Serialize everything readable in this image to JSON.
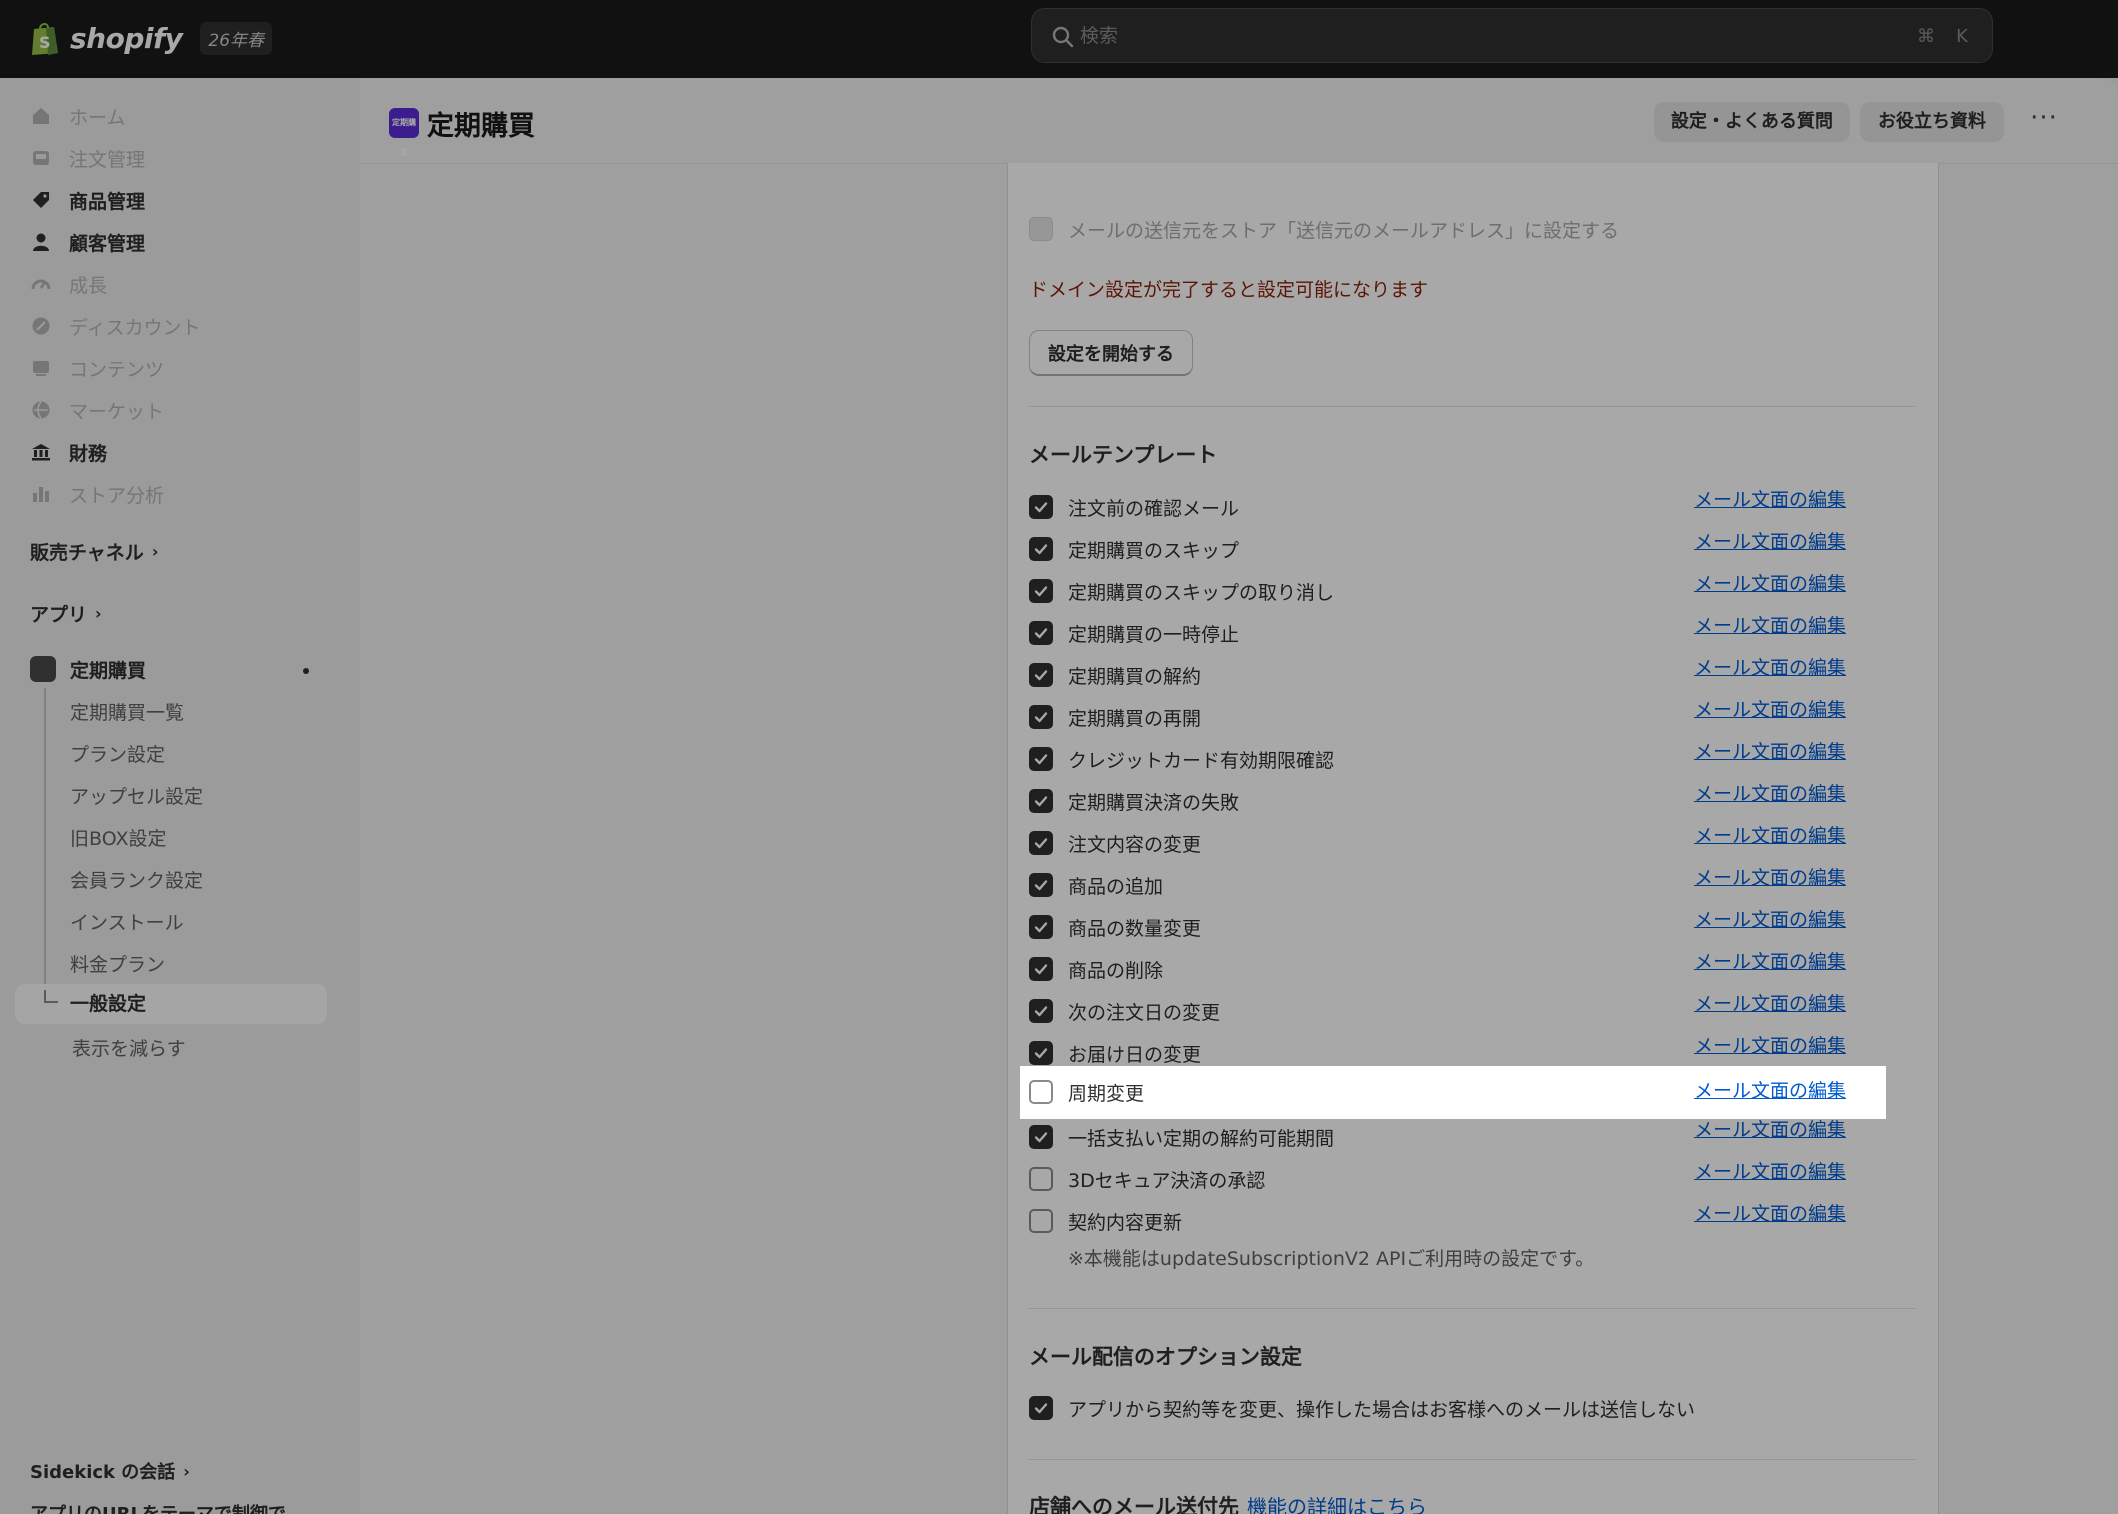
{
  "topbar": {
    "brand": "shopify",
    "badge": "26年春",
    "search_placeholder": "検索",
    "shortcut_cmd": "⌘",
    "shortcut_key": "K"
  },
  "sidebar": {
    "nav": [
      {
        "label": "ホーム",
        "icon": "home-icon"
      },
      {
        "label": "注文管理",
        "icon": "inbox-icon"
      },
      {
        "label": "商品管理",
        "icon": "tag-icon"
      },
      {
        "label": "顧客管理",
        "icon": "person-icon"
      },
      {
        "label": "成長",
        "icon": "gauge-icon"
      },
      {
        "label": "ディスカウント",
        "icon": "discount-icon"
      },
      {
        "label": "コンテンツ",
        "icon": "content-icon"
      },
      {
        "label": "マーケット",
        "icon": "globe-icon"
      },
      {
        "label": "財務",
        "icon": "bank-icon"
      },
      {
        "label": "ストア分析",
        "icon": "bar-chart-icon"
      }
    ],
    "sales_channel": "販売チャネル",
    "apps": "アプリ",
    "app_name": "定期購買",
    "app_subitems": [
      "定期購買一覧",
      "プラン設定",
      "アップセル設定",
      "旧BOX設定",
      "会員ランク設定",
      "インストール",
      "料金プラン",
      "一般設定"
    ],
    "show_less": "表示を減らす",
    "sidekick": "Sidekick の会話",
    "footer_cut": "アプリのURLをテーマで制御で"
  },
  "header": {
    "icon_label": "定期購買",
    "title": "定期購買",
    "btn_faq": "設定・よくある質問",
    "btn_docs": "お役立ち資料",
    "more": "···"
  },
  "sender": {
    "checkbox_label": "メールの送信元をストア「送信元のメールアドレス」に設定する",
    "warning": "ドメイン設定が完了すると設定可能になります",
    "start_button": "設定を開始する"
  },
  "templates": {
    "title": "メールテンプレート",
    "edit_label": "メール文面の編集",
    "items": [
      {
        "label": "注文前の確認メール",
        "checked": true
      },
      {
        "label": "定期購買のスキップ",
        "checked": true
      },
      {
        "label": "定期購買のスキップの取り消し",
        "checked": true
      },
      {
        "label": "定期購買の一時停止",
        "checked": true
      },
      {
        "label": "定期購買の解約",
        "checked": true
      },
      {
        "label": "定期購買の再開",
        "checked": true
      },
      {
        "label": "クレジットカード有効期限確認",
        "checked": true
      },
      {
        "label": "定期購買決済の失敗",
        "checked": true
      },
      {
        "label": "注文内容の変更",
        "checked": true
      },
      {
        "label": "商品の追加",
        "checked": true
      },
      {
        "label": "商品の数量変更",
        "checked": true
      },
      {
        "label": "商品の削除",
        "checked": true
      },
      {
        "label": "次の注文日の変更",
        "checked": true
      },
      {
        "label": "お届け日の変更",
        "checked": true
      },
      {
        "label": "周期変更",
        "checked": false
      },
      {
        "label": "一括支払い定期の解約可能期間",
        "checked": true
      },
      {
        "label": "3Dセキュア決済の承認",
        "checked": false
      },
      {
        "label": "契約内容更新",
        "checked": false
      }
    ],
    "note": "※本機能はupdateSubscriptionV2 APIご利用時の設定です。"
  },
  "options": {
    "title": "メール配信のオプション設定",
    "item": "アプリから契約等を変更、操作した場合はお客様へのメールは送信しない"
  },
  "store_email": {
    "title": "店舗へのメール送付先",
    "link": "機能の詳細はこちら"
  }
}
